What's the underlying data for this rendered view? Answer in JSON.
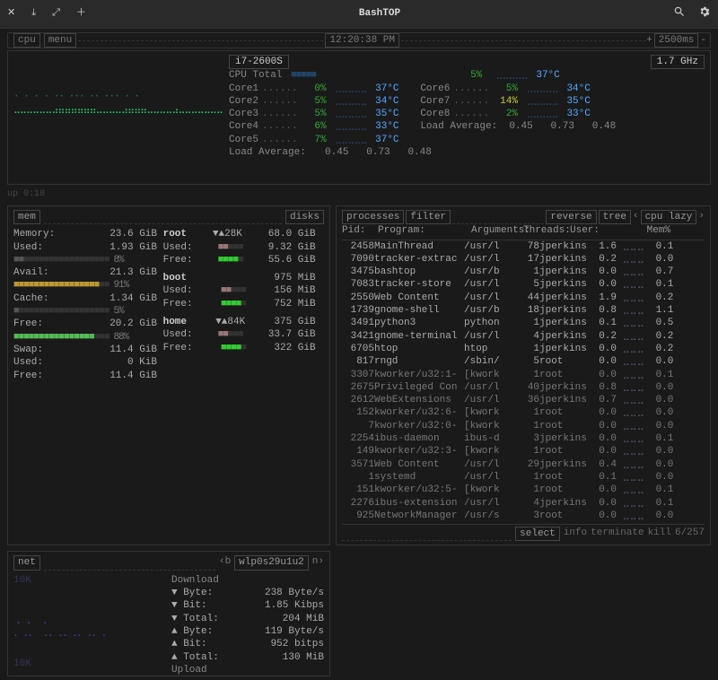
{
  "title": "BashTOP",
  "top": {
    "cpu": "cpu",
    "menu": "menu",
    "time": "12:20:38 PM",
    "refresh": "2500ms"
  },
  "cpu": {
    "name": "i7-2600S",
    "freq": "1.7 GHz",
    "total_label": "CPU Total",
    "total_pct": "5%",
    "total_temp": "37°C",
    "cores": [
      {
        "n": "Core1",
        "p": "0%",
        "t": "37°C"
      },
      {
        "n": "Core2",
        "p": "5%",
        "t": "34°C"
      },
      {
        "n": "Core3",
        "p": "5%",
        "t": "35°C"
      },
      {
        "n": "Core4",
        "p": "6%",
        "t": "33°C"
      },
      {
        "n": "Core5",
        "p": "7%",
        "t": "37°C"
      },
      {
        "n": "Core6",
        "p": "5%",
        "t": "34°C"
      },
      {
        "n": "Core7",
        "p": "14%",
        "t": "35°C"
      },
      {
        "n": "Core8",
        "p": "2%",
        "t": "33°C"
      }
    ],
    "load_label": "Load Average:",
    "load": "0.45   0.73   0.48",
    "uptime": "up 0:18"
  },
  "mem": {
    "hdr": "mem",
    "memory_l": "Memory:",
    "memory_v": "23.6 GiB",
    "used_l": "Used:",
    "used_v": "1.93 GiB",
    "used_p": "8%",
    "avail_l": "Avail:",
    "avail_v": "21.3 GiB",
    "avail_p": "91%",
    "cache_l": "Cache:",
    "cache_v": "1.34 GiB",
    "cache_p": "5%",
    "free_l": "Free:",
    "free_v": "20.2 GiB",
    "free_p": "88%",
    "swap_l": "Swap:",
    "swap_v": "11.4 GiB",
    "sused_l": "Used:",
    "sused_v": "0 KiB",
    "sfree_l": "Free:",
    "sfree_v": "11.4 GiB"
  },
  "disks": {
    "hdr": "disks",
    "root": {
      "name": "root",
      "io": "▼▲28K",
      "total": "68.0 GiB",
      "used_l": "Used:",
      "used_v": "9.32 GiB",
      "free_l": "Free:",
      "free_v": "55.6 GiB"
    },
    "boot": {
      "name": "boot",
      "total": "975 MiB",
      "used_l": "Used:",
      "used_v": "156 MiB",
      "free_l": "Free:",
      "free_v": "752 MiB"
    },
    "home": {
      "name": "home",
      "io": "▼▲84K",
      "total": "375 GiB",
      "used_l": "Used:",
      "used_v": "33.7 GiB",
      "free_l": "Free:",
      "free_v": "322 GiB"
    }
  },
  "proc": {
    "h": {
      "p": "processes",
      "f": "filter",
      "r": "reverse",
      "t": "tree",
      "s": "cpu lazy"
    },
    "cols": {
      "pid": "Pid:",
      "prog": "Program:",
      "args": "Arguments:",
      "thr": "Threads:",
      "usr": "User:",
      "mem": "Mem%"
    },
    "rows": [
      {
        "pid": "2458",
        "prog": "MainThread",
        "args": "/usr/l",
        "thr": "78",
        "usr": "jperkins",
        "cpu": "1.6",
        "mem": "0.1"
      },
      {
        "pid": "7090",
        "prog": "tracker-extrac",
        "args": "/usr/l",
        "thr": "17",
        "usr": "jperkins",
        "cpu": "0.2",
        "mem": "0.0"
      },
      {
        "pid": "3475",
        "prog": "bashtop",
        "args": "/usr/b",
        "thr": "1",
        "usr": "jperkins",
        "cpu": "0.0",
        "mem": "0.7"
      },
      {
        "pid": "7083",
        "prog": "tracker-store",
        "args": "/usr/l",
        "thr": "5",
        "usr": "jperkins",
        "cpu": "0.0",
        "mem": "0.1"
      },
      {
        "pid": "2550",
        "prog": "Web Content",
        "args": "/usr/l",
        "thr": "44",
        "usr": "jperkins",
        "cpu": "1.9",
        "mem": "0.2"
      },
      {
        "pid": "1739",
        "prog": "gnome-shell",
        "args": "/usr/b",
        "thr": "18",
        "usr": "jperkins",
        "cpu": "0.8",
        "mem": "1.1"
      },
      {
        "pid": "3491",
        "prog": "python3",
        "args": "python",
        "thr": "1",
        "usr": "jperkins",
        "cpu": "0.1",
        "mem": "0.5"
      },
      {
        "pid": "3421",
        "prog": "gnome-terminal",
        "args": "/usr/l",
        "thr": "4",
        "usr": "jperkins",
        "cpu": "0.2",
        "mem": "0.2"
      },
      {
        "pid": "6705",
        "prog": "htop",
        "args": "htop",
        "thr": "1",
        "usr": "jperkins",
        "cpu": "0.0",
        "mem": "0.2"
      },
      {
        "pid": "817",
        "prog": "rngd",
        "args": "/sbin/",
        "thr": "5",
        "usr": "root",
        "cpu": "0.0",
        "mem": "0.0"
      },
      {
        "pid": "3307",
        "prog": "kworker/u32:1-",
        "args": "[kwork",
        "thr": "1",
        "usr": "root",
        "cpu": "0.0",
        "mem": "0.1"
      },
      {
        "pid": "2675",
        "prog": "Privileged Con",
        "args": "/usr/l",
        "thr": "40",
        "usr": "jperkins",
        "cpu": "0.8",
        "mem": "0.0"
      },
      {
        "pid": "2612",
        "prog": "WebExtensions",
        "args": "/usr/l",
        "thr": "36",
        "usr": "jperkins",
        "cpu": "0.7",
        "mem": "0.0"
      },
      {
        "pid": "152",
        "prog": "kworker/u32:6-",
        "args": "[kwork",
        "thr": "1",
        "usr": "root",
        "cpu": "0.0",
        "mem": "0.0"
      },
      {
        "pid": "7",
        "prog": "kworker/u32:0-",
        "args": "[kwork",
        "thr": "1",
        "usr": "root",
        "cpu": "0.0",
        "mem": "0.0"
      },
      {
        "pid": "2254",
        "prog": "ibus-daemon",
        "args": "ibus-d",
        "thr": "3",
        "usr": "jperkins",
        "cpu": "0.0",
        "mem": "0.1"
      },
      {
        "pid": "149",
        "prog": "kworker/u32:3-",
        "args": "[kwork",
        "thr": "1",
        "usr": "root",
        "cpu": "0.0",
        "mem": "0.0"
      },
      {
        "pid": "3571",
        "prog": "Web Content",
        "args": "/usr/l",
        "thr": "29",
        "usr": "jperkins",
        "cpu": "0.4",
        "mem": "0.0"
      },
      {
        "pid": "1",
        "prog": "systemd",
        "args": "/usr/l",
        "thr": "1",
        "usr": "root",
        "cpu": "0.1",
        "mem": "0.0"
      },
      {
        "pid": "151",
        "prog": "kworker/u32:5-",
        "args": "[kwork",
        "thr": "1",
        "usr": "root",
        "cpu": "0.0",
        "mem": "0.1"
      },
      {
        "pid": "2276",
        "prog": "ibus-extension",
        "args": "/usr/l",
        "thr": "4",
        "usr": "jperkins",
        "cpu": "0.0",
        "mem": "0.1"
      },
      {
        "pid": "925",
        "prog": "NetworkManager",
        "args": "/usr/s",
        "thr": "3",
        "usr": "root",
        "cpu": "0.0",
        "mem": "0.0"
      }
    ],
    "footer": {
      "sel": "select",
      "info": "info",
      "term": "terminate",
      "kill": "kill",
      "pos": "6/257"
    }
  },
  "net": {
    "hdr": "net",
    "iface": "wlp0s29u1u2",
    "dl_hdr": "Download",
    "dl": [
      {
        "l": "▼ Byte:",
        "v": "238 Byte/s"
      },
      {
        "l": "▼ Bit:",
        "v": "1.85 Kibps"
      },
      {
        "l": "▼ Total:",
        "v": "204 MiB"
      }
    ],
    "ul": [
      {
        "l": "▲ Byte:",
        "v": "119 Byte/s"
      },
      {
        "l": "▲ Bit:",
        "v": "952 bitps"
      },
      {
        "l": "▲ Total:",
        "v": "130 MiB"
      }
    ],
    "ul_hdr": "Upload",
    "scale": "10K"
  }
}
